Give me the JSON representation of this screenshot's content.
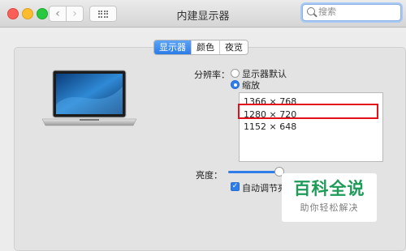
{
  "window": {
    "title": "内建显示器"
  },
  "toolbar": {
    "back_icon": "chevron-left-icon",
    "forward_icon": "chevron-right-icon",
    "grid_icon": "grid-icon"
  },
  "search": {
    "placeholder": "搜索"
  },
  "tabs": [
    {
      "label": "显示器",
      "active": true
    },
    {
      "label": "颜色",
      "active": false
    },
    {
      "label": "夜览",
      "active": false
    }
  ],
  "resolution": {
    "label": "分辨率：",
    "options": [
      {
        "label": "显示器默认",
        "selected": false
      },
      {
        "label": "缩放",
        "selected": true
      }
    ],
    "list": [
      "1366 × 768",
      "1280 × 720",
      "1152 × 648"
    ],
    "selected": "1280 × 720"
  },
  "brightness": {
    "label": "亮度：",
    "level": 0.9,
    "auto_label": "自动调节亮度",
    "auto_checked": true
  },
  "watermark": {
    "main": "百科全说",
    "sub": "助你轻松解决"
  },
  "colors": {
    "accent": "#2f7de8",
    "highlight_box": "#e3101c",
    "watermark_green": "#1d9b57"
  }
}
